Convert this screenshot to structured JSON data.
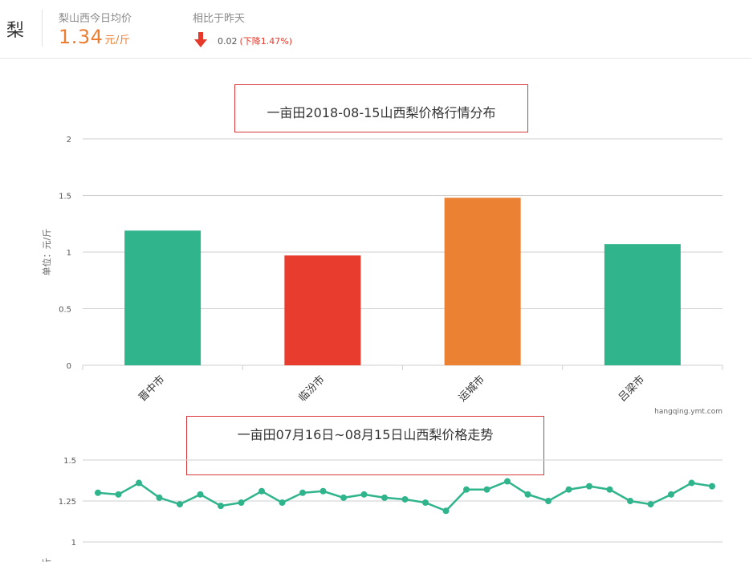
{
  "header": {
    "product": "梨",
    "avg_label": "梨山西今日均价",
    "avg_price": "1.34",
    "avg_unit": "元/斤",
    "compare_label": "相比于昨天",
    "compare_value": "0.02",
    "compare_change": "(下降1.47%)",
    "trend_icon": "arrow-down-icon",
    "accent_color": "#eb7e33",
    "down_color": "#e6392b"
  },
  "chart_data": [
    {
      "type": "bar",
      "title": "一亩田2018-08-15山西梨价格行情分布",
      "ylabel": "单位：元/斤",
      "categories": [
        "晋中市",
        "临汾市",
        "运城市",
        "吕梁市"
      ],
      "values": [
        1.19,
        0.97,
        1.48,
        1.07
      ],
      "colors": [
        "#2fb48c",
        "#e73c2e",
        "#eb8233",
        "#2fb48c"
      ],
      "ylim": [
        0,
        2
      ],
      "yticks": [
        "0",
        "0.5",
        "1",
        "1.5",
        "2"
      ],
      "grid": true,
      "source": "hangqing.ymt.com"
    },
    {
      "type": "line",
      "title": "一亩田07月16日~08月15日山西梨价格走势",
      "ylabel": "斤",
      "values": [
        1.3,
        1.29,
        1.36,
        1.27,
        1.23,
        1.29,
        1.22,
        1.24,
        1.31,
        1.24,
        1.3,
        1.31,
        1.27,
        1.29,
        1.27,
        1.26,
        1.24,
        1.19,
        1.32,
        1.32,
        1.37,
        1.29,
        1.25,
        1.32,
        1.34,
        1.32,
        1.25,
        1.23,
        1.29,
        1.36,
        1.34
      ],
      "color": "#2fb48c",
      "yticks": [
        "1",
        "1.25",
        "1.5"
      ],
      "grid": true
    }
  ]
}
